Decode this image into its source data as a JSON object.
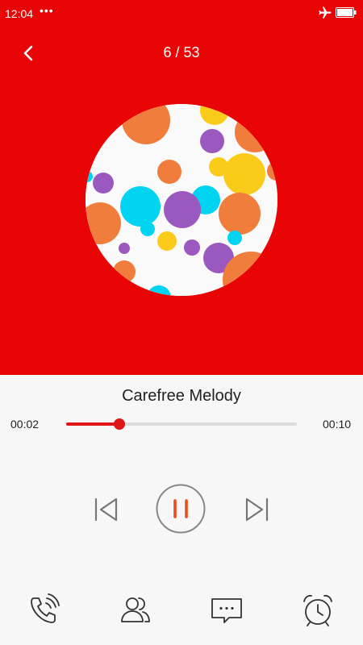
{
  "status_bar": {
    "time": "12:04",
    "dots": "•••",
    "icons": [
      "airplane-mode-icon",
      "battery-icon"
    ]
  },
  "header": {
    "back_icon": "chevron-left-icon",
    "counter": "6 / 53"
  },
  "colors": {
    "header_bg": "#e90505",
    "accent": "#e01515",
    "pause_icon": "#f04a1a",
    "control_gray": "#777777",
    "art_orange": "#f07d3c",
    "art_yellow": "#fbcb1a",
    "art_purple": "#9b59c0",
    "art_cyan": "#00d4f0"
  },
  "track": {
    "title": "Carefree Melody",
    "elapsed": "00:02",
    "duration": "00:10",
    "progress": 0.23
  },
  "controls": {
    "prev_icon": "skip-previous-icon",
    "pause_icon": "pause-icon",
    "next_icon": "skip-next-icon"
  },
  "bottom_bar": {
    "icons": [
      "phone-call-icon",
      "contacts-icon",
      "message-icon",
      "alarm-clock-icon"
    ]
  }
}
